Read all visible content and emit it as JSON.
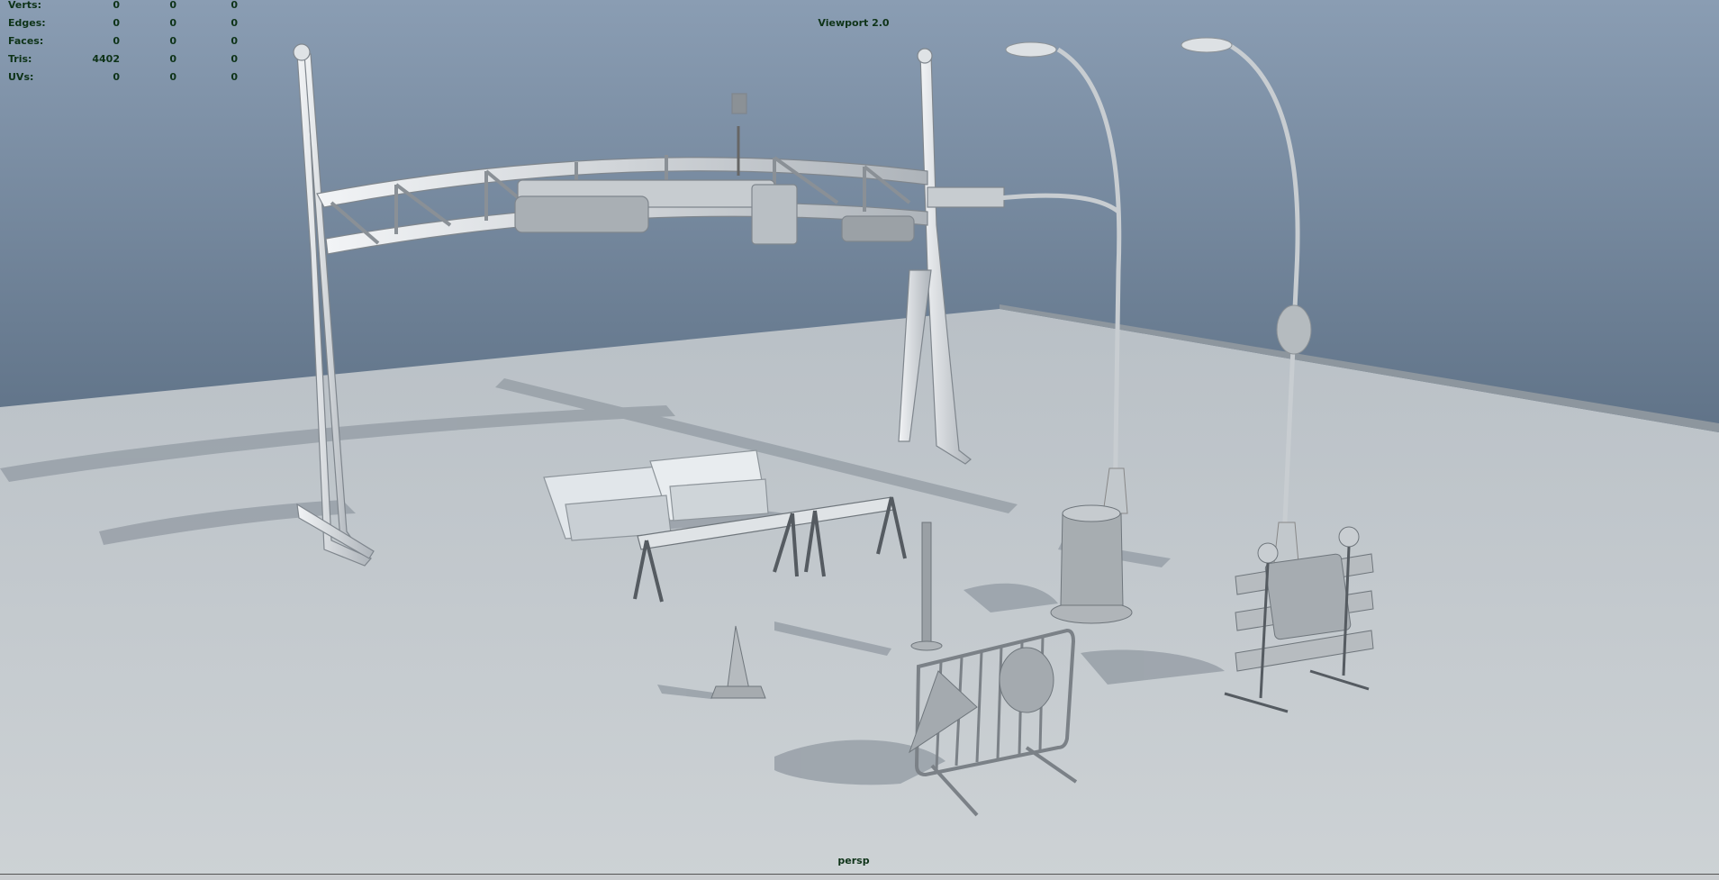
{
  "hud": {
    "title": "Viewport 2.0",
    "camera": "persp",
    "stats": [
      {
        "label": "Verts:",
        "values": [
          "0",
          "0",
          "0"
        ]
      },
      {
        "label": "Edges:",
        "values": [
          "0",
          "0",
          "0"
        ]
      },
      {
        "label": "Faces:",
        "values": [
          "0",
          "0",
          "0"
        ]
      },
      {
        "label": "Tris:",
        "values": [
          "4402",
          "0",
          "0"
        ]
      },
      {
        "label": "UVs:",
        "values": [
          "0",
          "0",
          "0"
        ]
      }
    ]
  },
  "scene": {
    "objects": [
      "overhead-sign-gantry",
      "traffic-signal",
      "street-light",
      "street-light",
      "jersey-barrier",
      "sawhorse-barricade",
      "traffic-cone",
      "bollard",
      "trash-can",
      "pedestrian-barricade",
      "sign-board-barricade"
    ]
  },
  "colors": {
    "hud_text": "#0e3318",
    "background_top": "#8a9db3",
    "floor": "#c4cace"
  }
}
